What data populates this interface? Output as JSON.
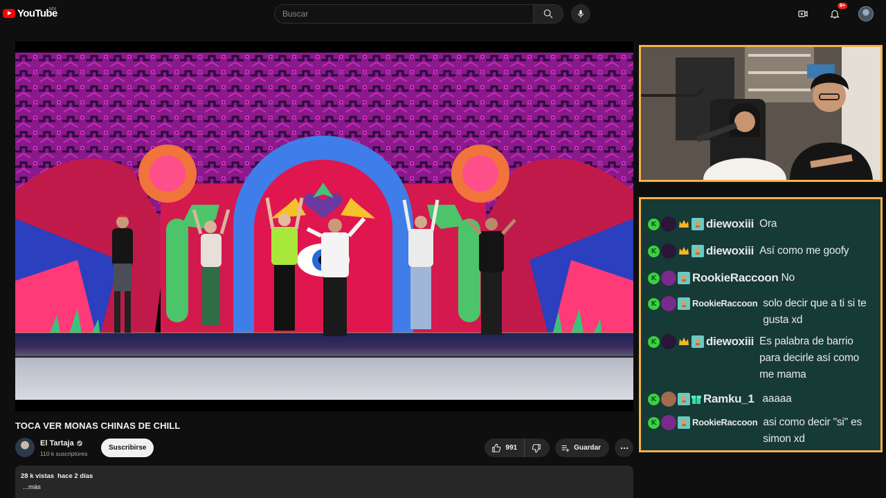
{
  "header": {
    "logo_text": "YouTube",
    "region": "MX",
    "search_placeholder": "Buscar",
    "notification_count": "9+"
  },
  "video": {
    "title": "TOCA VER MONAS CHINAS DE CHILL",
    "channel_name": "El Tartaja",
    "subscribers": "110 k suscriptores",
    "subscribe_label": "Suscribirse",
    "likes": "991",
    "save_label": "Guardar",
    "views": "28 k vistas",
    "uploaded": "hace 2 días",
    "more_label": "...más"
  },
  "chat": {
    "messages": [
      {
        "user": "diewoxiii",
        "text": "Ora",
        "avatar_color": "#2a1636",
        "badge": "crown",
        "name_size": "large"
      },
      {
        "user": "diewoxiii",
        "text": "Así como me goofy",
        "avatar_color": "#2a1636",
        "badge": "crown",
        "name_size": "large"
      },
      {
        "user": "RookieRaccoon",
        "text": "No",
        "avatar_color": "#7a2a8a",
        "badge": "none",
        "name_size": "large"
      },
      {
        "user": "RookieRaccoon",
        "text": "solo decir que a ti si te gusta xd",
        "avatar_color": "#7a2a8a",
        "badge": "none",
        "name_size": "small"
      },
      {
        "user": "diewoxiii",
        "text": "Es palabra de barrio para decirle así como me mama",
        "avatar_color": "#2a1636",
        "badge": "crown",
        "name_size": "large"
      },
      {
        "user": "Ramku_1",
        "text": "aaaaa",
        "avatar_color": "#a06b4f",
        "badge": "gift",
        "name_size": "large"
      },
      {
        "user": "RookieRaccoon",
        "text": "asi como decir \"si\" es simon xd",
        "avatar_color": "#7a2a8a",
        "badge": "none",
        "name_size": "small"
      }
    ]
  },
  "colors": {
    "accent_border": "#f7b24d",
    "chat_bg": "#163a35",
    "brand_red": "#ff0000"
  }
}
